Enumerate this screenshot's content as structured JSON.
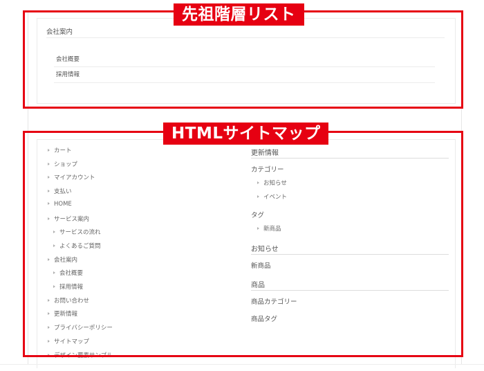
{
  "annotations": {
    "ancestor_label": "先祖階層リスト",
    "sitemap_label": "HTMLサイトマップ"
  },
  "ancestor_list": {
    "title": "会社案内",
    "items": [
      "会社概要",
      "採用情報"
    ]
  },
  "sitemap": {
    "left": [
      {
        "label": "カート",
        "level": 0
      },
      {
        "label": "ショップ",
        "level": 0
      },
      {
        "label": "マイアカウント",
        "level": 0
      },
      {
        "label": "支払い",
        "level": 0
      },
      {
        "label": "HOME",
        "level": 0
      },
      {
        "label": "サービス案内",
        "level": 0
      },
      {
        "label": "サービスの流れ",
        "level": 1
      },
      {
        "label": "よくあるご質問",
        "level": 1
      },
      {
        "label": "会社案内",
        "level": 0
      },
      {
        "label": "会社概要",
        "level": 1
      },
      {
        "label": "採用情報",
        "level": 1
      },
      {
        "label": "お問い合わせ",
        "level": 0
      },
      {
        "label": "更新情報",
        "level": 0
      },
      {
        "label": "プライバシーポリシー",
        "level": 0
      },
      {
        "label": "サイトマップ",
        "level": 0
      },
      {
        "label": "デザイン要素サンプル",
        "level": 0
      }
    ],
    "right": {
      "section1_heading": "更新情報",
      "category_title": "カテゴリー",
      "category_items": [
        "お知らせ",
        "イベント"
      ],
      "tag_title": "タグ",
      "tag_items": [
        "新商品"
      ],
      "section2_heading": "お知らせ",
      "section2_item": "新商品",
      "section3_heading": "商品",
      "section3_items": [
        "商品カテゴリー",
        "商品タグ"
      ]
    }
  }
}
